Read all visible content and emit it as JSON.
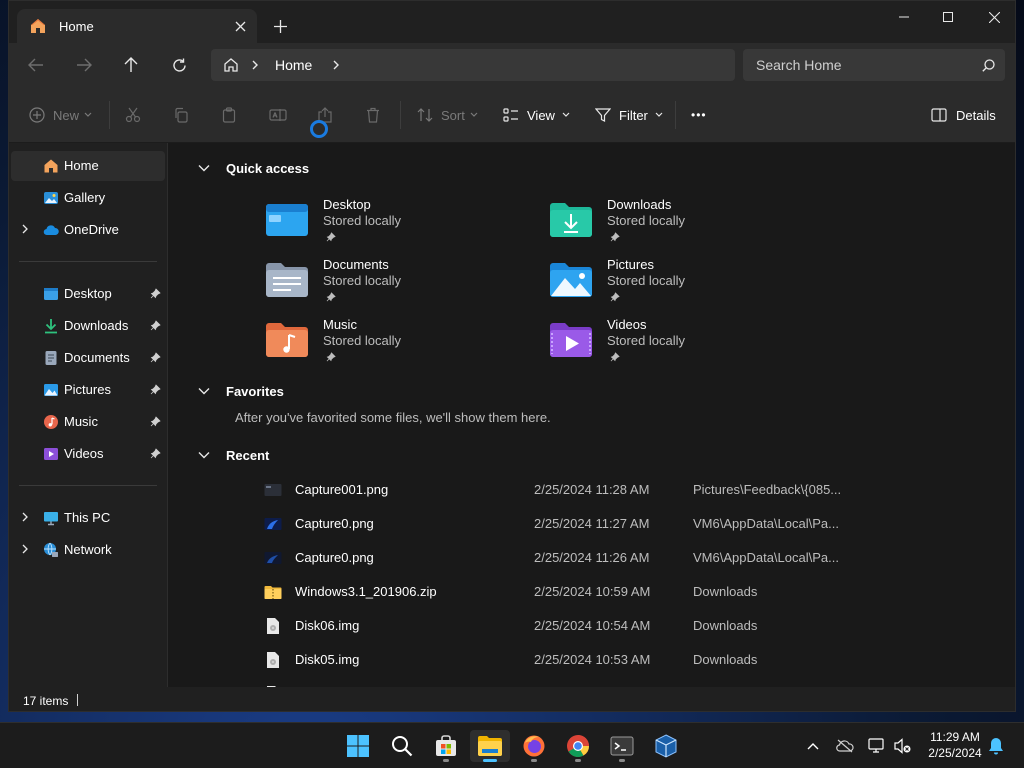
{
  "window": {
    "tab_title": "Home",
    "address": "Home",
    "search_placeholder": "Search Home"
  },
  "toolbar": {
    "new_label": "New",
    "sort_label": "Sort",
    "view_label": "View",
    "filter_label": "Filter",
    "more_label": "•••",
    "details_label": "Details"
  },
  "sidebar": {
    "items": [
      {
        "label": "Home"
      },
      {
        "label": "Gallery"
      },
      {
        "label": "OneDrive"
      },
      {
        "label": "Desktop"
      },
      {
        "label": "Downloads"
      },
      {
        "label": "Documents"
      },
      {
        "label": "Pictures"
      },
      {
        "label": "Music"
      },
      {
        "label": "Videos"
      },
      {
        "label": "This PC"
      },
      {
        "label": "Network"
      }
    ]
  },
  "main": {
    "quick_access_title": "Quick access",
    "quick_access": [
      {
        "name": "Desktop",
        "sub": "Stored locally"
      },
      {
        "name": "Downloads",
        "sub": "Stored locally"
      },
      {
        "name": "Documents",
        "sub": "Stored locally"
      },
      {
        "name": "Pictures",
        "sub": "Stored locally"
      },
      {
        "name": "Music",
        "sub": "Stored locally"
      },
      {
        "name": "Videos",
        "sub": "Stored locally"
      }
    ],
    "favorites_title": "Favorites",
    "favorites_message": "After you've favorited some files, we'll show them here.",
    "recent_title": "Recent",
    "recent": [
      {
        "name": "Capture001.png",
        "date": "2/25/2024 11:28 AM",
        "location": "Pictures\\Feedback\\{085..."
      },
      {
        "name": "Capture0.png",
        "date": "2/25/2024 11:27 AM",
        "location": "VM6\\AppData\\Local\\Pa..."
      },
      {
        "name": "Capture0.png",
        "date": "2/25/2024 11:26 AM",
        "location": "VM6\\AppData\\Local\\Pa..."
      },
      {
        "name": "Windows3.1_201906.zip",
        "date": "2/25/2024 10:59 AM",
        "location": "Downloads"
      },
      {
        "name": "Disk06.img",
        "date": "2/25/2024 10:54 AM",
        "location": "Downloads"
      },
      {
        "name": "Disk05.img",
        "date": "2/25/2024 10:53 AM",
        "location": "Downloads"
      }
    ]
  },
  "status": {
    "item_count": "17 items"
  },
  "taskbar": {
    "time": "11:29 AM",
    "date": "2/25/2024"
  },
  "colors": {
    "accent": "#4cc2ff",
    "window_bg": "#191919",
    "panel_bg": "#2b2b2b"
  }
}
